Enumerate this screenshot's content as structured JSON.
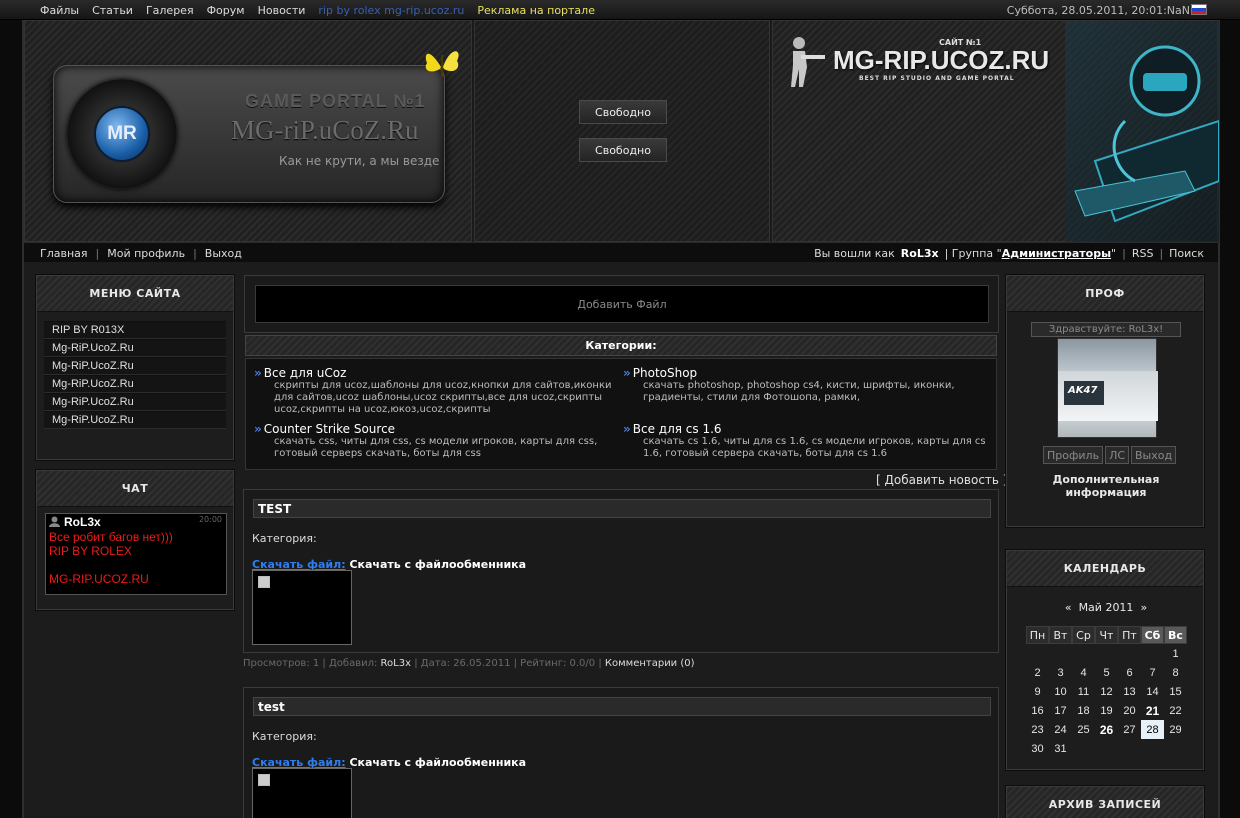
{
  "topbar": {
    "nav": [
      "Файлы",
      "Статьи",
      "Галерея",
      "Форум",
      "Новости"
    ],
    "rip": "rip by rolex mg-rip.ucoz.ru",
    "adv": "Реклама на портале",
    "date": "Суббота, 28.05.2011, 20:01:NaN"
  },
  "header": {
    "logo_text": "MR",
    "portal_line1": "GAME PORTAL №1",
    "portal_line2": "MG-riP.uCoZ.Ru",
    "slogan": "Как не крути, а мы везде",
    "free1": "Свободно",
    "free2": "Свободно",
    "site_num": "САЙТ №1",
    "site_title": "MG-RIP.UCOZ.RU",
    "site_sub": "BEST RIP STUDIO AND GAME PORTAL"
  },
  "userbar": {
    "home": "Главная",
    "profile": "Мой профиль",
    "logout": "Выход",
    "logged_as": "Вы вошли как",
    "user": "RoL3x",
    "group_label": "| Группа \"",
    "group": "Администраторы",
    "group_end": "\"",
    "rss": "RSS",
    "search": "Поиск"
  },
  "site_menu": {
    "title": "МЕНЮ САЙТА",
    "items": [
      "RIP BY R013X",
      "Mg-RiP.UcoZ.Ru",
      "Mg-RiP.UcoZ.Ru",
      "Mg-RiP.UcoZ.Ru",
      "Mg-RiP.UcoZ.Ru",
      "Mg-RiP.UcoZ.Ru"
    ]
  },
  "chat": {
    "title": "ЧАТ",
    "user": "RoL3x",
    "time": "20:00",
    "lines": [
      "Все робит багов нет)))",
      "RIP BY ROLEX",
      "",
      "MG-RIP.UCOZ.RU"
    ]
  },
  "center": {
    "add_file": "Добавить Файл",
    "categories_title": "Категории:",
    "categories": [
      {
        "title": "Все для uCoz",
        "desc": "скрипты для ucoz,шаблоны для ucoz,кнопки для сайтов,иконки для сайтов,ucoz шаблоны,ucoz скрипты,все для ucoz,скрипты ucoz,скрипты на ucoz,юкоз,ucoz,скрипты"
      },
      {
        "title": "PhotoShop",
        "desc": "скачать photoshop, photoshop cs4, кисти, шрифты, иконки, градиенты, стили для Фотошопа, рамки,"
      },
      {
        "title": "Counter Strike Source",
        "desc": "скачать css, читы для css, cs модели игроков, карты для css, готовый серверs скачать, боты для css"
      },
      {
        "title": "Все для cs 1.6",
        "desc": "скачать cs 1.6, читы для cs 1.6, cs модели игроков, карты для cs 1.6, готовый сервера скачать, боты для cs 1.6"
      }
    ],
    "add_news": "[ Добавить новость ]",
    "posts": [
      {
        "title": "TEST",
        "cat": "Категория:",
        "dl_label": "Скачать файл:",
        "dl_text": "Скачать с файлообменника"
      },
      {
        "title": "test",
        "cat": "Категория:",
        "dl_label": "Скачать файл:",
        "dl_text": "Скачать с файлообменника"
      }
    ],
    "meta": {
      "views": "Просмотров: 1 | Добавил:",
      "author": "RoL3x",
      "date": "| Дата: 26.05.2011 | Рейтинг: 0.0/0 |",
      "comments": "Комментарии (0)"
    }
  },
  "prof": {
    "title": "ПРОФ",
    "greeting": "Здравствуйте: RoL3x!",
    "avatar_text": "AK47",
    "btn_profile": "Профиль",
    "btn_ls": "ЛС",
    "btn_exit": "Выход",
    "extra": "Дополнительная информация"
  },
  "calendar": {
    "title": "КАЛЕНДАРЬ",
    "prev": "«",
    "month": "Май 2011",
    "next": "»",
    "days": [
      "Пн",
      "Вт",
      "Ср",
      "Чт",
      "Пт",
      "Сб",
      "Вс"
    ],
    "weeks": [
      [
        "",
        "",
        "",
        "",
        "",
        "",
        "1"
      ],
      [
        "2",
        "3",
        "4",
        "5",
        "6",
        "7",
        "8"
      ],
      [
        "9",
        "10",
        "11",
        "12",
        "13",
        "14",
        "15"
      ],
      [
        "16",
        "17",
        "18",
        "19",
        "20",
        "21",
        "22"
      ],
      [
        "23",
        "24",
        "25",
        "26",
        "27",
        "28",
        "29"
      ],
      [
        "30",
        "31",
        "",
        "",
        "",
        "",
        ""
      ]
    ],
    "bold_days": [
      "21",
      "26"
    ],
    "today": "28"
  },
  "archive": {
    "title": "АРХИВ ЗАПИСЕЙ"
  }
}
